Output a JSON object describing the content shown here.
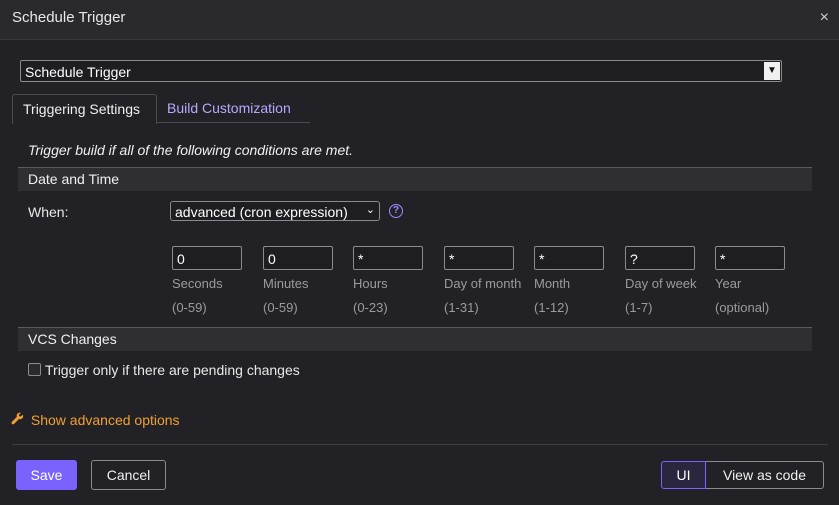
{
  "dialog": {
    "title": "Schedule Trigger"
  },
  "trigger_type": {
    "selected": "Schedule Trigger"
  },
  "tabs": [
    {
      "label": "Triggering Settings",
      "active": true
    },
    {
      "label": "Build Customization",
      "active": false
    }
  ],
  "intro": "Trigger build if all of the following conditions are met.",
  "sections": {
    "date_time": "Date and Time",
    "vcs": "VCS Changes"
  },
  "when": {
    "label": "When:",
    "selected": "advanced (cron expression)"
  },
  "cron": [
    {
      "value": "0",
      "label": "Seconds",
      "range": "(0-59)"
    },
    {
      "value": "0",
      "label": "Minutes",
      "range": "(0-59)"
    },
    {
      "value": "*",
      "label": "Hours",
      "range": "(0-23)"
    },
    {
      "value": "*",
      "label": "Day of month",
      "range": "(1-31)"
    },
    {
      "value": "*",
      "label": "Month",
      "range": "(1-12)"
    },
    {
      "value": "?",
      "label": "Day of week",
      "range": "(1-7)"
    },
    {
      "value": "*",
      "label": "Year",
      "range": "(optional)"
    }
  ],
  "vcs_checkbox": {
    "label": "Trigger only if there are pending changes",
    "checked": false
  },
  "advanced_link": "Show advanced options",
  "footer": {
    "save": "Save",
    "cancel": "Cancel",
    "view_ui": "UI",
    "view_code": "View as code"
  },
  "colors": {
    "accent": "#7a62ff",
    "link": "#b9a8ff",
    "warning_link": "#f0a033"
  }
}
